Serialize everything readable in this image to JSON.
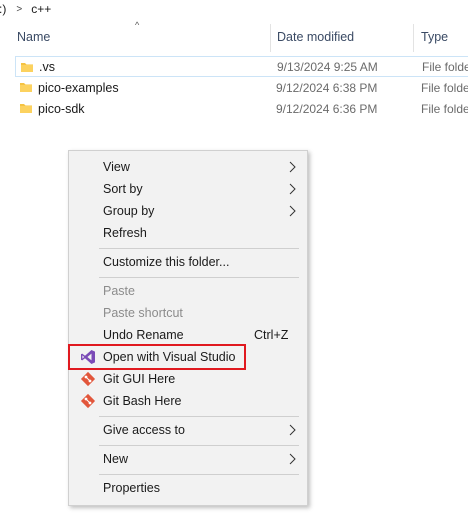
{
  "breadcrumb": {
    "parent": ":)",
    "separator": ">",
    "current": "c++"
  },
  "header": {
    "name": "Name",
    "date_modified": "Date modified",
    "type": "Type",
    "sort_caret": "^"
  },
  "files": [
    {
      "name": ".vs",
      "date": "9/13/2024 9:25 AM",
      "type": "File folde"
    },
    {
      "name": "pico-examples",
      "date": "9/12/2024 6:38 PM",
      "type": "File folde"
    },
    {
      "name": "pico-sdk",
      "date": "9/12/2024 6:36 PM",
      "type": "File folde"
    }
  ],
  "context_menu": {
    "view": "View",
    "sort_by": "Sort by",
    "group_by": "Group by",
    "refresh": "Refresh",
    "customize": "Customize this folder...",
    "paste": "Paste",
    "paste_shortcut": "Paste shortcut",
    "undo_rename": "Undo Rename",
    "undo_shortcut": "Ctrl+Z",
    "open_vs": "Open with Visual Studio",
    "git_gui": "Git GUI Here",
    "git_bash": "Git Bash Here",
    "give_access": "Give access to",
    "new": "New",
    "properties": "Properties"
  },
  "icons": {
    "folder": "folder-icon",
    "visual_studio": "visual-studio-icon",
    "git": "git-icon",
    "submenu": "chevron-right-icon"
  },
  "colors": {
    "highlight_border": "#e0191f",
    "folder": "#f5c342",
    "visual_studio": "#7b4bb7",
    "git": "#e2563b"
  }
}
